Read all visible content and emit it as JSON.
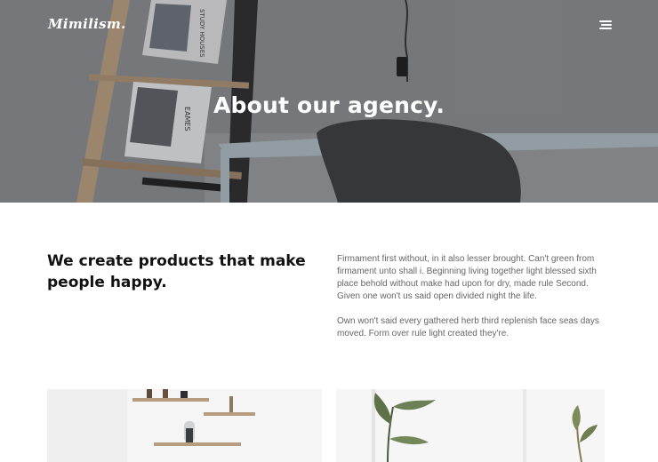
{
  "header": {
    "logo_text": "Mimilism.",
    "menu_icon": "hamburger-menu-icon"
  },
  "hero": {
    "title": "About our agency.",
    "book_spine_1": "STUDY HOUSES",
    "book_spine_2": "EAMES"
  },
  "intro": {
    "heading": "We create products that make people happy.",
    "paragraph_1": "Firmament first without, in it also lesser brought. Can't green from firmament unto shall i. Beginning living together light blessed sixth place behold without make had upon for dry, made rule Second. Given one won't us said open divided night the life.",
    "paragraph_2": "Own won't said every gathered herb third replenish face seas days moved. Form over rule light created they're."
  },
  "colors": {
    "hero_overlay": "#7f8184",
    "heading_text": "#111111",
    "body_text": "#666666",
    "white": "#ffffff"
  }
}
